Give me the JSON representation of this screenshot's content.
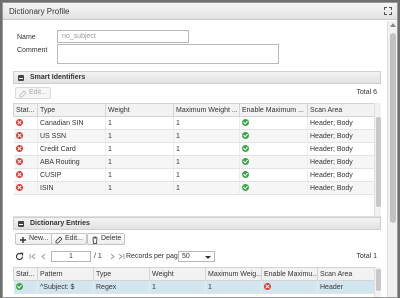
{
  "dialog": {
    "title": "Dictionary Profile"
  },
  "form": {
    "name_label": "Name",
    "name_value": "no_subject",
    "comment_label": "Comment",
    "comment_value": ""
  },
  "smart_identifiers": {
    "title": "Smart Identifiers",
    "edit_label": "Edit...",
    "total": "Total 6",
    "columns": [
      "Stat...",
      "Type",
      "Weight",
      "Maximum Weight ...",
      "Enable Maximum ...",
      "Scan Area"
    ],
    "rows": [
      {
        "status": "disabled",
        "type": "Canadian SIN",
        "weight": "1",
        "max_weight": "1",
        "enable_max": "enabled",
        "scan_area": "Header; Body"
      },
      {
        "status": "disabled",
        "type": "US SSN",
        "weight": "1",
        "max_weight": "1",
        "enable_max": "enabled",
        "scan_area": "Header; Body"
      },
      {
        "status": "disabled",
        "type": "Credit Card",
        "weight": "1",
        "max_weight": "1",
        "enable_max": "enabled",
        "scan_area": "Header; Body"
      },
      {
        "status": "disabled",
        "type": "ABA Routing",
        "weight": "1",
        "max_weight": "1",
        "enable_max": "enabled",
        "scan_area": "Header; Body"
      },
      {
        "status": "disabled",
        "type": "CUSIP",
        "weight": "1",
        "max_weight": "1",
        "enable_max": "enabled",
        "scan_area": "Header; Body"
      },
      {
        "status": "disabled",
        "type": "ISIN",
        "weight": "1",
        "max_weight": "1",
        "enable_max": "enabled",
        "scan_area": "Header; Body"
      }
    ]
  },
  "dictionary_entries": {
    "title": "Dictionary Entries",
    "new_label": "New...",
    "edit_label": "Edit...",
    "delete_label": "Delete",
    "total": "Total 1",
    "pager": {
      "page": "1",
      "of_pages": "/ 1",
      "records_per_page_label": "Records per page",
      "records_per_page": "50"
    },
    "columns": [
      "Stat...",
      "Pattern",
      "Type",
      "Weight",
      "Maximum Weig...",
      "Enable Maximu...",
      "Scan Area"
    ],
    "rows": [
      {
        "status": "enabled",
        "pattern": "^Subject: $",
        "type": "Regex",
        "weight": "1",
        "max_weight": "1",
        "enable_max": "disabled",
        "scan_area": "Header"
      }
    ]
  },
  "colors": {
    "enabled": "#3aa548",
    "disabled": "#d9382f",
    "selected_row": "#d2e6ef"
  }
}
